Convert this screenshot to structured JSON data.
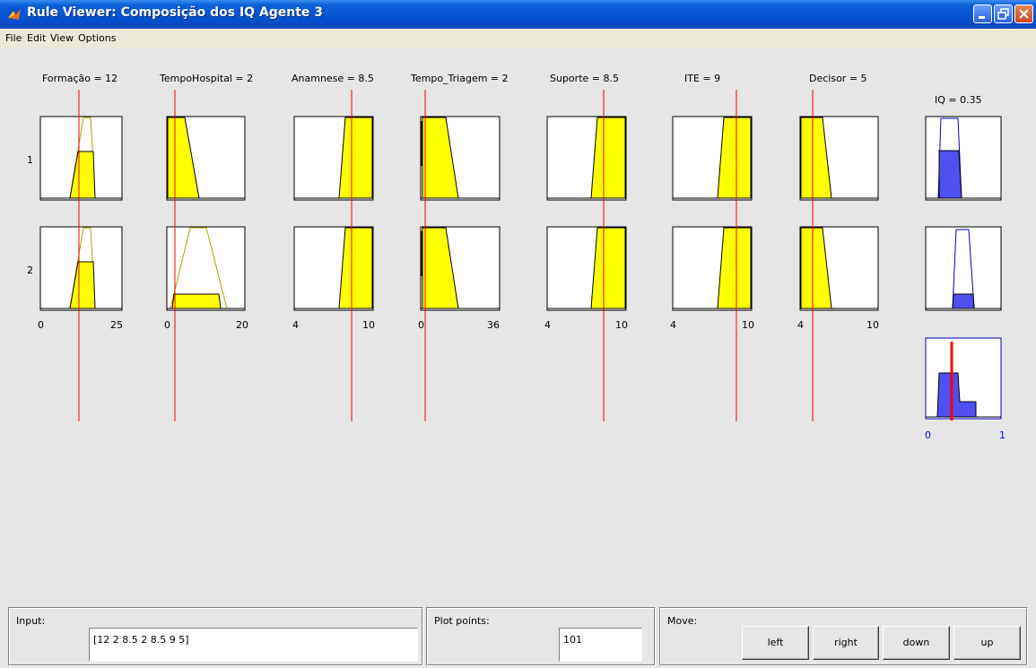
{
  "window": {
    "title": "Rule Viewer: Composição dos IQ Agente 3",
    "icon": "matlab-icon",
    "controls": [
      "minimize-icon",
      "restore-icon",
      "close-icon"
    ]
  },
  "menu": [
    "File",
    "Edit",
    "View",
    "Options"
  ],
  "inputs": [
    {
      "label": "Formação = 12",
      "range_min": "0",
      "range_max": "25"
    },
    {
      "label": "TempoHospital = 2",
      "range_min": "0",
      "range_max": "20"
    },
    {
      "label": "Anamnese = 8.5",
      "range_min": "4",
      "range_max": "10"
    },
    {
      "label": "Tempo_Triagem = 2",
      "range_min": "0",
      "range_max": "36"
    },
    {
      "label": "Suporte = 8.5",
      "range_min": "4",
      "range_max": "10"
    },
    {
      "label": "ITE = 9",
      "range_min": "4",
      "range_max": "10"
    },
    {
      "label": "Decisor = 5",
      "range_min": "4",
      "range_max": "10"
    }
  ],
  "rules": [
    "1",
    "2"
  ],
  "output": {
    "label": "IQ = 0.35",
    "range_min": "0",
    "range_max": "1",
    "value": 0.35
  },
  "controls": {
    "input_label": "Input:",
    "input_value": "[12 2 8.5 2 8.5 9 5]",
    "plot_points_label": "Plot points:",
    "plot_points_value": "101",
    "move_label": "Move:",
    "buttons": [
      "left",
      "right",
      "down",
      "up"
    ]
  },
  "colors": {
    "input_fill": "#ffff00",
    "output_fill": "#5050f0",
    "line_red": "#ff0000",
    "title_bar": "#0553d0"
  }
}
